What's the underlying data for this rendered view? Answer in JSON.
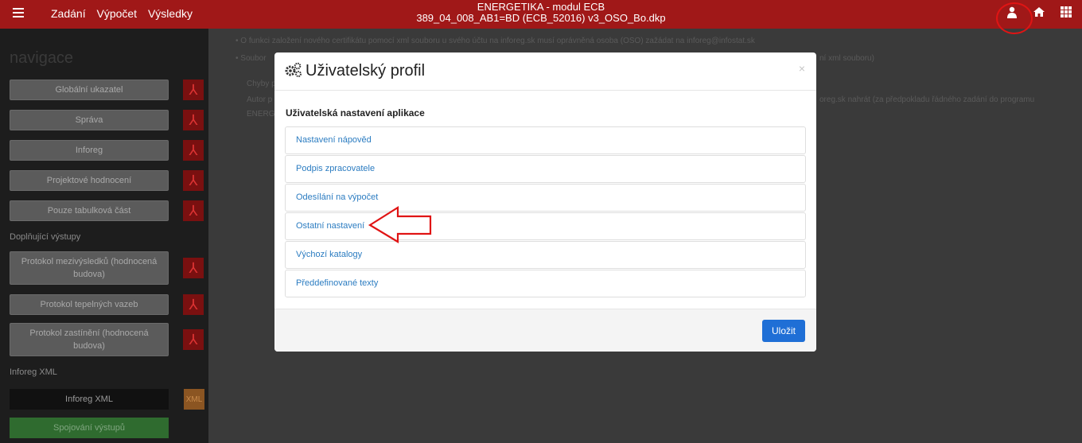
{
  "topbar": {
    "menu": [
      "Zadání",
      "Výpočet",
      "Výsledky"
    ],
    "title_line1": "ENERGETIKA - modul ECB",
    "title_line2": "389_04_008_AB1=BD (ECB_52016) v3_OSO_Bo.dkp",
    "icons": [
      "user-icon",
      "home-icon",
      "grid-icon"
    ]
  },
  "sidebar": {
    "title": "navigace",
    "buttons": [
      "Globální ukazatel",
      "Správa",
      "Inforeg",
      "Projektové hodnocení",
      "Pouze tabulková část"
    ],
    "section_outputs": "Doplňující výstupy",
    "output_buttons": [
      "Protokol mezivýsledků (hodnocená budova)",
      "Protokol tepelných vazeb",
      "Protokol zastínění (hodnocená budova)"
    ],
    "section_xml": "Inforeg XML",
    "xml_button": "Inforeg XML",
    "xml_icon": "XML",
    "green_button": "Spojování výstupů"
  },
  "background": {
    "line1": "• O funkci založení nového certifikátu pomocí xml souboru u svého účtu na inforeg.sk musí oprávněná osoba (OSO) zažádat na inforeg@infostat.sk",
    "line2_start": "• Soubor",
    "line2_end": "ní xml souboru)",
    "line3": "Chyby p",
    "line4_start": "Autor p",
    "line4_end": "oreg.sk nahrát (za předpokladu řádného zadání do programu",
    "line5": "ENERG"
  },
  "modal": {
    "title": "Uživatelský profil",
    "close": "×",
    "subtitle": "Uživatelská nastavení aplikace",
    "items": [
      "Nastavení nápověd",
      "Podpis zpracovatele",
      "Odesílání na výpočet",
      "Ostatní nastavení",
      "Výchozí katalogy",
      "Předdefinované texty"
    ],
    "save_label": "Uložit"
  },
  "colors": {
    "topbar": "#a01818",
    "accent": "#1f6fd6",
    "link": "#2b7cc1",
    "annotation": "#e01414"
  }
}
